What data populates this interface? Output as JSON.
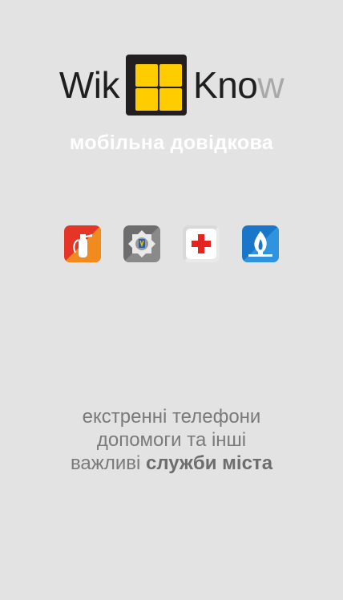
{
  "logo": {
    "left_text": "Wik",
    "right_text": "Kno",
    "right_fade_text": "w"
  },
  "subtitle": "мобільна довідкова",
  "services": [
    {
      "icon": "fire-extinguisher-icon",
      "color": "#e53527"
    },
    {
      "icon": "police-badge-icon",
      "color": "#6d6d6d"
    },
    {
      "icon": "medical-cross-icon",
      "color": "#e42320"
    },
    {
      "icon": "gas-flame-icon",
      "color": "#1976c8"
    }
  ],
  "tagline": {
    "line1": "екстренні телефони",
    "line2": "допомоги та інші",
    "line3_plain": "важливі ",
    "line3_bold": "служби міста"
  }
}
